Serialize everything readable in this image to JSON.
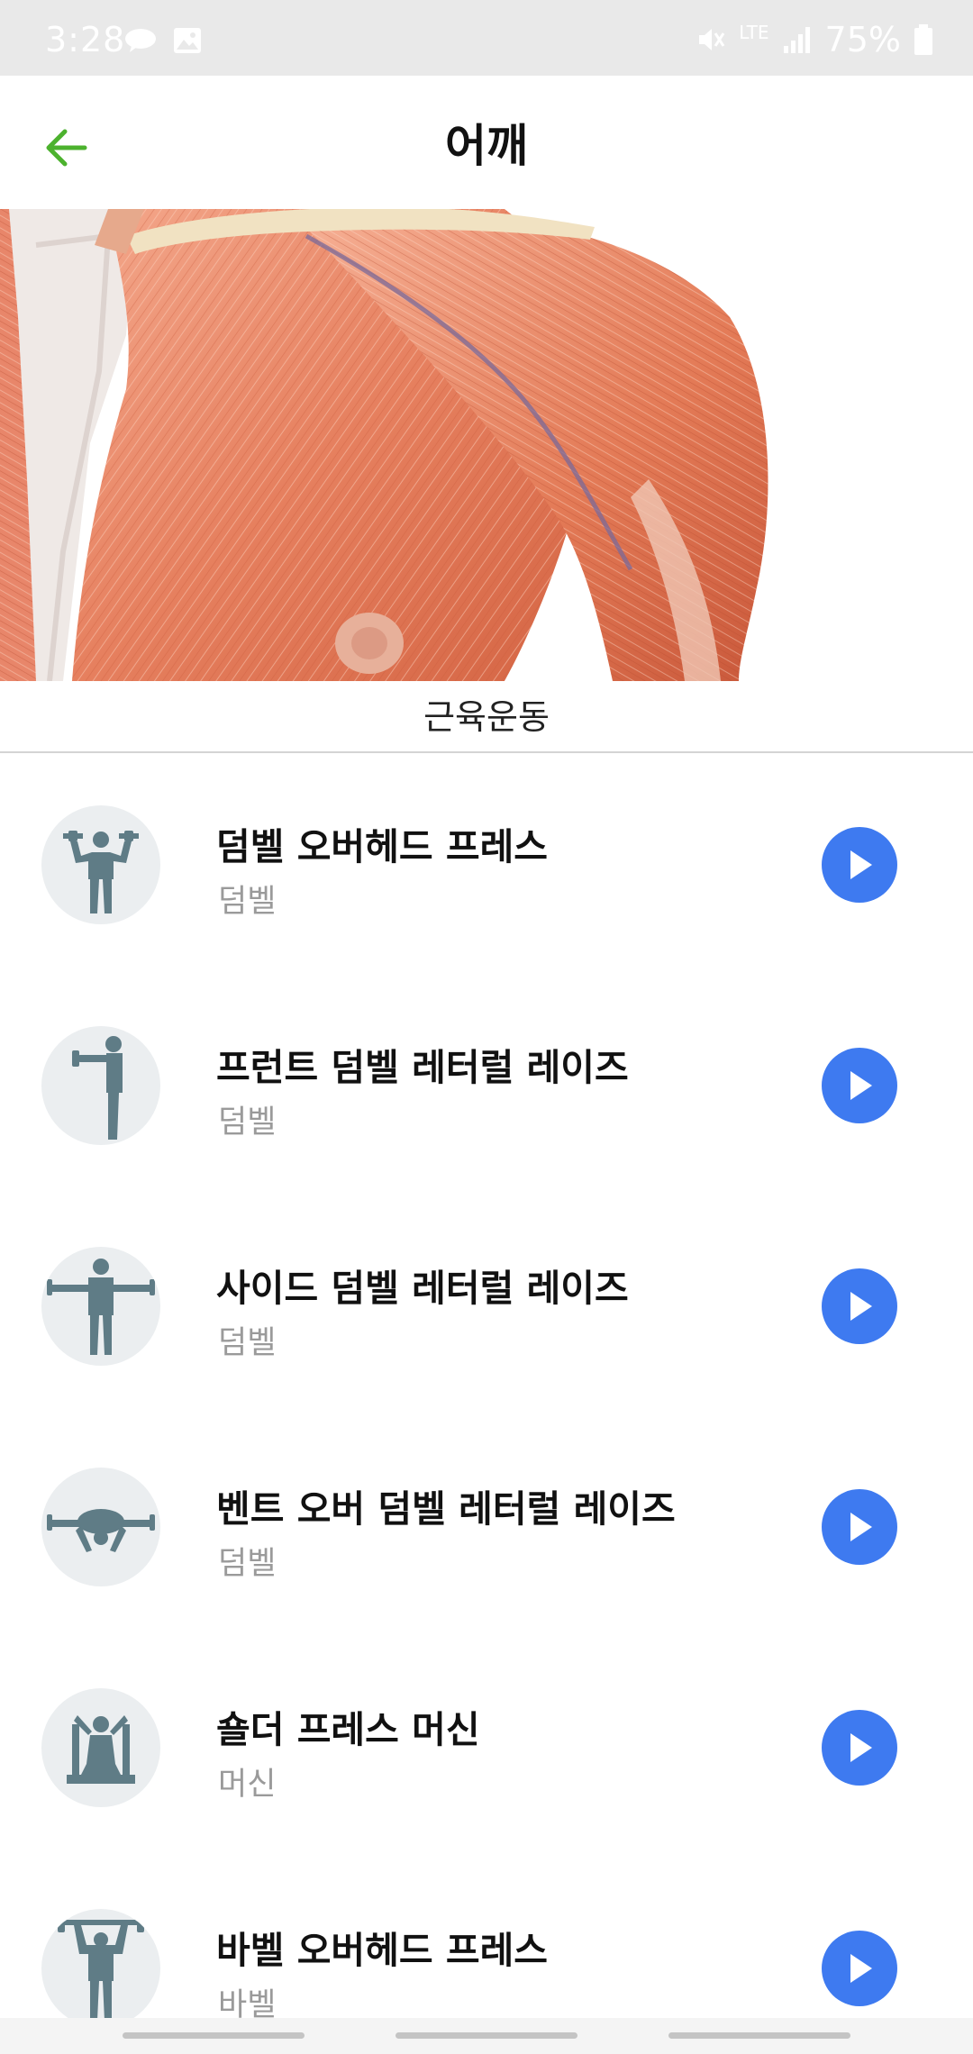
{
  "status_bar": {
    "time": "3:28",
    "network": "LTE",
    "battery": "75%"
  },
  "header": {
    "title": "어깨",
    "back_icon": "arrow-left-icon",
    "accent_color": "#4cb22e"
  },
  "section": {
    "label": "근육운동"
  },
  "exercises": [
    {
      "name": "덤벨 오버헤드 프레스",
      "equipment": "덤벨",
      "icon": "dumbbell-overhead-press-icon"
    },
    {
      "name": "프런트 덤벨 레터럴 레이즈",
      "equipment": "덤벨",
      "icon": "front-raise-icon"
    },
    {
      "name": "사이드 덤벨 레터럴 레이즈",
      "equipment": "덤벨",
      "icon": "side-raise-icon"
    },
    {
      "name": "벤트 오버 덤벨 레터럴 레이즈",
      "equipment": "덤벨",
      "icon": "bent-over-raise-icon"
    },
    {
      "name": "숄더 프레스 머신",
      "equipment": "머신",
      "icon": "shoulder-press-machine-icon"
    },
    {
      "name": "바벨 오버헤드 프레스",
      "equipment": "바벨",
      "icon": "barbell-overhead-press-icon"
    }
  ],
  "colors": {
    "play_button": "#3e7af0",
    "avatar_bg": "#ebeef0",
    "figure": "#5f7c86"
  }
}
